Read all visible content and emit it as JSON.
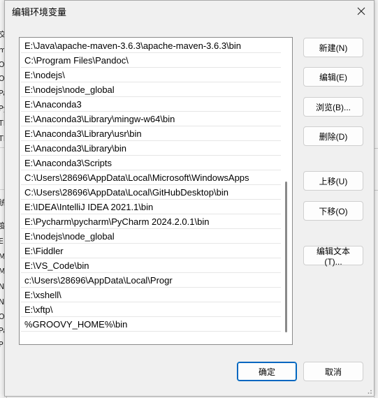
{
  "dialog": {
    "title": "编辑环境变量"
  },
  "paths": [
    "E:\\Java\\apache-maven-3.6.3\\apache-maven-3.6.3\\bin",
    "C:\\Program Files\\Pandoc\\",
    "E:\\nodejs\\",
    "E:\\nodejs\\node_global",
    "E:\\Anaconda3",
    "E:\\Anaconda3\\Library\\mingw-w64\\bin",
    "E:\\Anaconda3\\Library\\usr\\bin",
    "E:\\Anaconda3\\Library\\bin",
    "E:\\Anaconda3\\Scripts",
    "C:\\Users\\28696\\AppData\\Local\\Microsoft\\WindowsApps",
    "C:\\Users\\28696\\AppData\\Local\\GitHubDesktop\\bin",
    "E:\\IDEA\\IntelliJ IDEA 2021.1\\bin",
    "E:\\Pycharm\\pycharm\\PyCharm 2024.2.0.1\\bin",
    "E:\\nodejs\\node_global",
    "E:\\Fiddler",
    "E:\\VS_Code\\bin",
    "c:\\Users\\28696\\AppData\\Local\\Progr",
    "E:\\xshell\\",
    "E:\\xftp\\",
    "%GROOVY_HOME%\\bin"
  ],
  "buttons": {
    "new": "新建(N)",
    "edit": "编辑(E)",
    "browse": "浏览(B)...",
    "delete": "删除(D)",
    "move_up": "上移(U)",
    "move_down": "下移(O)",
    "edit_text": "编辑文本(T)...",
    "ok": "确定",
    "cancel": "取消"
  },
  "background": {
    "left_chars": [
      "交",
      "m",
      "Or",
      "Or",
      "Pa",
      "Py",
      "TE",
      "TM",
      "统",
      "变",
      "E",
      "M",
      "M",
      "N",
      "N",
      "O",
      "Pa",
      "P"
    ]
  },
  "colors": {
    "accent": "#0067c0",
    "dialog_bg": "#f0f0f0"
  }
}
